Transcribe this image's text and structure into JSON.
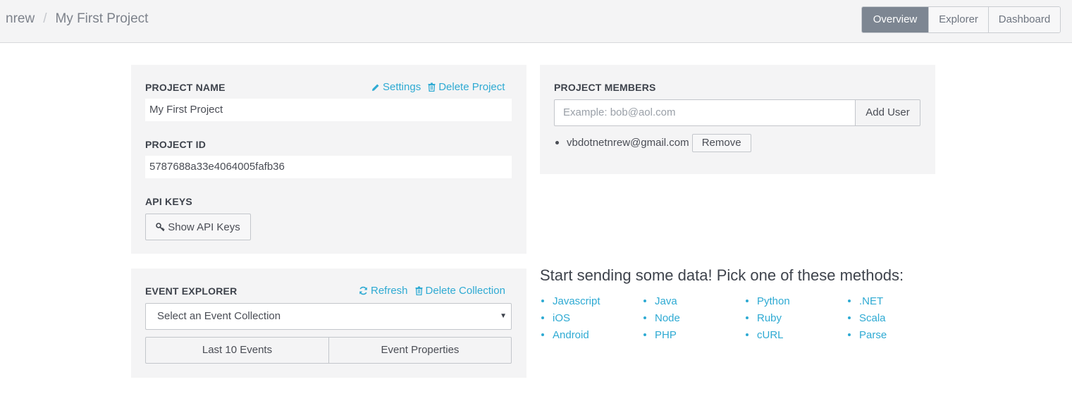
{
  "breadcrumb": {
    "user": "nrew",
    "separator": "/",
    "project": "My First Project"
  },
  "nav": {
    "overview": "Overview",
    "explorer": "Explorer",
    "dashboard": "Dashboard",
    "active": "Overview"
  },
  "project_panel": {
    "name_label": "PROJECT NAME",
    "settings_link": "Settings",
    "delete_link": "Delete Project",
    "name_value": "My First Project",
    "id_label": "PROJECT ID",
    "id_value": "5787688a33e4064005fafb36",
    "api_label": "API KEYS",
    "show_api_keys": "Show API Keys"
  },
  "members_panel": {
    "label": "PROJECT MEMBERS",
    "input_placeholder": "Example: bob@aol.com",
    "add_user": "Add User",
    "members": [
      {
        "email": "vbdotnetnrew@gmail.com",
        "remove_label": "Remove"
      }
    ]
  },
  "explorer_panel": {
    "label": "EVENT EXPLORER",
    "refresh_link": "Refresh",
    "delete_collection_link": "Delete Collection",
    "select_value": "Select an Event Collection",
    "last_events": "Last 10 Events",
    "event_properties": "Event Properties"
  },
  "methods": {
    "heading": "Start sending some data! Pick one of these methods:",
    "items": [
      "Javascript",
      "Java",
      "Python",
      ".NET",
      "iOS",
      "Node",
      "Ruby",
      "Scala",
      "Android",
      "PHP",
      "cURL",
      "Parse"
    ]
  },
  "colors": {
    "accent": "#2eaad3",
    "panel_bg": "#f4f4f5",
    "nav_active": "#7d8692"
  },
  "icons": [
    "pencil-icon",
    "trash-icon",
    "key-icon",
    "refresh-icon",
    "caret-down-icon"
  ]
}
